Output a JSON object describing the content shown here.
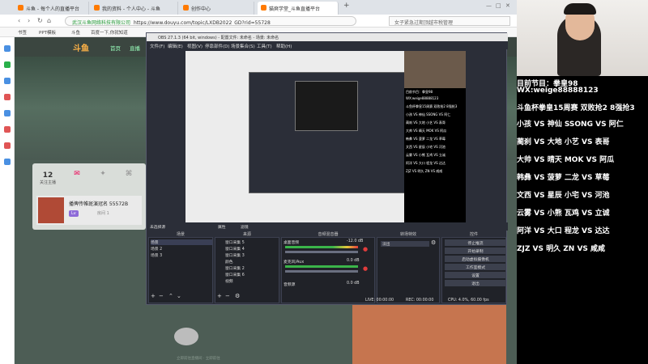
{
  "browser": {
    "tabs": [
      {
        "label": "斗鱼 - 每个人的直播平台",
        "color": "#ff7a00"
      },
      {
        "label": "我的资料 - 个人中心 - 斗鱼",
        "color": "#ff7a00"
      },
      {
        "label": "创作中心",
        "color": "#ff7a00"
      },
      {
        "label": "猫爽学堂_斗鱼直播平台",
        "color": "#ff7a00"
      }
    ],
    "url_secure": "武汉斗鱼网络科技有限公司",
    "url": "https://www.douyu.com/topic/LXDB2022_GD?rid=55728",
    "search_placeholder": "女子紧急过期顶越市税管理",
    "bookmarks": [
      "书签",
      "PPT模板",
      "斗鱼",
      "百度一下,你就知道"
    ]
  },
  "site": {
    "logo": "斗鱼",
    "nav": [
      "首页",
      "直播"
    ],
    "stats": [
      {
        "value": "12",
        "label": "关注主播"
      },
      {
        "value": "",
        "label": ""
      },
      {
        "value": "",
        "label": ""
      }
    ],
    "room_name": "播俾传帷斑演冠名 55572B",
    "room_tag": "Lv",
    "room_sub": "房间 1",
    "footer": "立即前往直播间 · 立即前往"
  },
  "obs": {
    "title": "OBS 27.1.3 (64 bit, windows) - 配置文件: 未命名 - 场景: 未命名",
    "menu": [
      "文件(F)",
      "编辑(E)",
      "视图(V)",
      "停靠部件(D)",
      "场景集合(S)",
      "工具(T)",
      "帮助(H)"
    ],
    "source_bar": "未选择源",
    "props_label": "属性",
    "filters_label": "滤镜",
    "docks": {
      "scenes": {
        "title": "场景",
        "items": [
          "场景",
          "场景 2",
          "场景 3"
        ]
      },
      "sources": {
        "title": "来源",
        "items": [
          "窗口采集 5",
          "窗口采集 4",
          "窗口采集 3",
          "颜色",
          "窗口采集 2",
          "窗口采集 6",
          "视频"
        ]
      },
      "mixer": {
        "title": "音频混音器",
        "items": [
          "桌面音频",
          "麦克风/Aux",
          "音频源"
        ],
        "levels": [
          "-12.0 dB",
          "0.0 dB",
          "0.0 dB"
        ]
      },
      "transitions": {
        "title": "转场特效",
        "selected": "淡出",
        "duration_label": "时长",
        "duration": "300 ms"
      },
      "controls": {
        "title": "控件",
        "buttons": [
          "停止推流",
          "开始录制",
          "启动虚拟摄像机",
          "工作室模式",
          "设置",
          "退出"
        ]
      }
    },
    "status": {
      "live": "LIVE: 00:00:00",
      "rec": "REC: 00:00:00",
      "cpu": "CPU: 4.0%, 60.00 fps"
    }
  },
  "overlay": {
    "lines": [
      "目前节目：拳皇98",
      "WX:weige88888123",
      "斗鱼杯拳皇15周赛 双败抢2 8强抢3",
      "小孩 VS 神仙 SSONG VS 阿仁",
      "蔺刹 VS 大地 小艺 VS 表哥",
      "大帅 VS 晴天 MOK VS 阿瓜",
      "韩彝 VS 菠萝 二龙 VS 草莓",
      "文西 VS 星辰 小宅 VS 河池",
      "云雾 VS 小熊 瓦鸡 VS 立诚",
      "阿洋 VS 大口 程龙 VS 达达",
      "ZJZ VS 明久 ZN VS 咸咸"
    ]
  },
  "colors": {
    "accent": "#ff7a00",
    "obs_bg": "#2b2e38",
    "page_bg": "#4d5d55",
    "record_red": "#e03c3c"
  }
}
